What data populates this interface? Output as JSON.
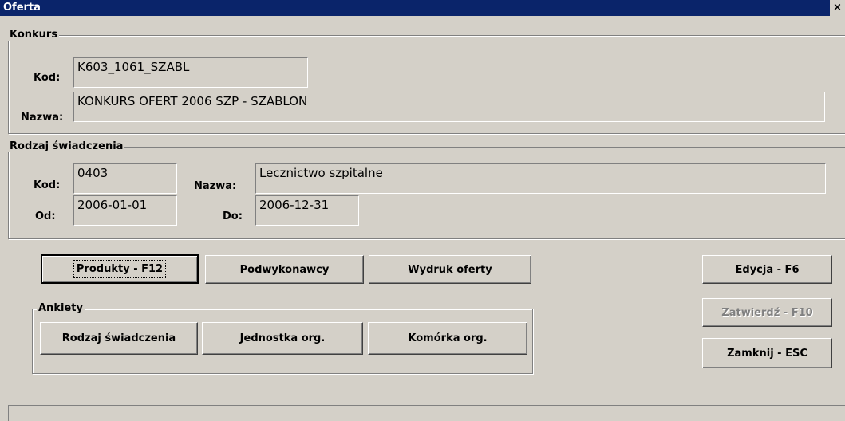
{
  "window": {
    "title": "Oferta",
    "close_glyph": "×"
  },
  "konkurs": {
    "legend": "Konkurs",
    "kod_label": "Kod:",
    "kod_value": "K603_1061_SZABL",
    "nazwa_label": "Nazwa:",
    "nazwa_value": "KONKURS OFERT 2006 SZP - SZABLON"
  },
  "rodzaj": {
    "legend": "Rodzaj świadczenia",
    "kod_label": "Kod:",
    "kod_value": "0403",
    "nazwa_label": "Nazwa:",
    "nazwa_value": "Lecznictwo szpitalne",
    "od_label": "Od:",
    "od_value": "2006-01-01",
    "do_label": "Do:",
    "do_value": "2006-12-31"
  },
  "buttons": {
    "produkty": "Produkty - F12",
    "podwykonawcy": "Podwykonawcy",
    "wydruk": "Wydruk oferty",
    "edycja": "Edycja - F6",
    "zatwierdz": "Zatwierdź - F10",
    "zamknij": "Zamknij - ESC"
  },
  "ankiety": {
    "legend": "Ankiety",
    "rodzaj": "Rodzaj świadczenia",
    "jednostka": "Jednostka org.",
    "komorka": "Komórka org."
  }
}
